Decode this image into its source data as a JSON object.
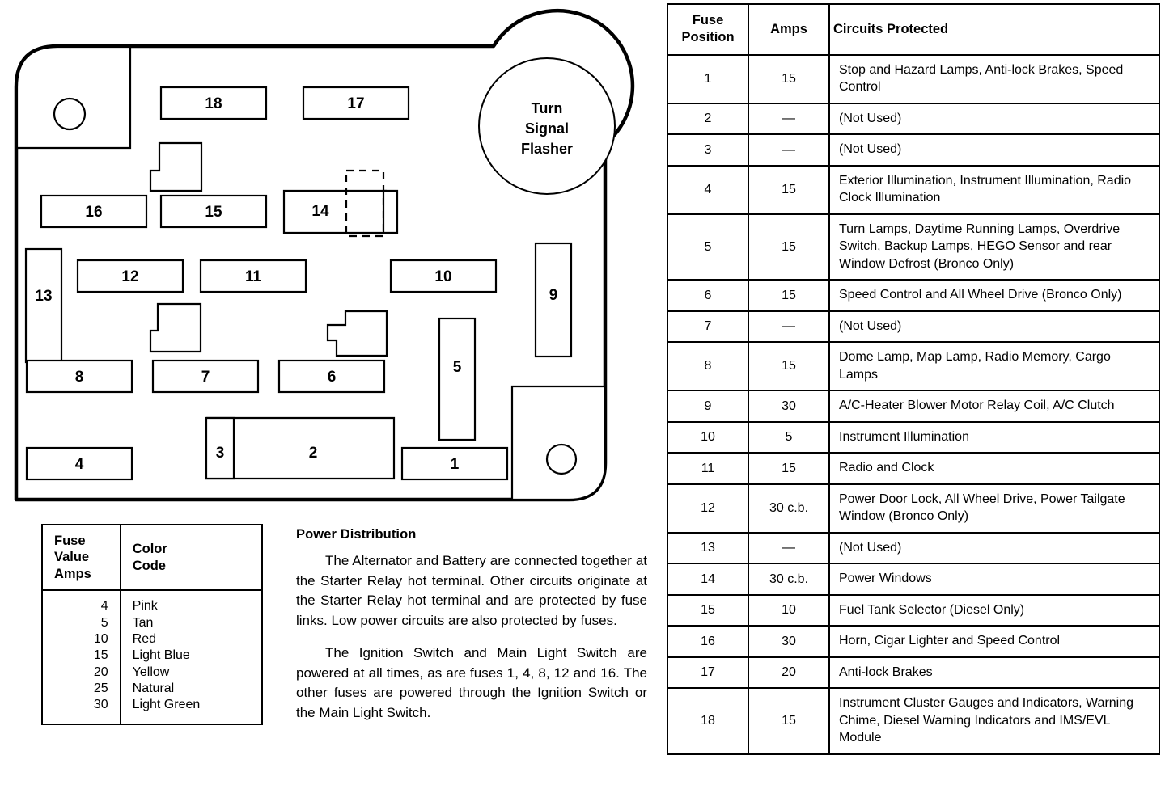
{
  "diagram": {
    "title": "fuse-panel-diagram",
    "flasher_label_lines": [
      "Turn",
      "Signal",
      "Flasher"
    ],
    "fuse_slots": [
      {
        "id": "18",
        "label": "18"
      },
      {
        "id": "17",
        "label": "17"
      },
      {
        "id": "16",
        "label": "16"
      },
      {
        "id": "15",
        "label": "15"
      },
      {
        "id": "14",
        "label": "14"
      },
      {
        "id": "13",
        "label": "13"
      },
      {
        "id": "12",
        "label": "12"
      },
      {
        "id": "11",
        "label": "11"
      },
      {
        "id": "10",
        "label": "10"
      },
      {
        "id": "9",
        "label": "9"
      },
      {
        "id": "8",
        "label": "8"
      },
      {
        "id": "7",
        "label": "7"
      },
      {
        "id": "6",
        "label": "6"
      },
      {
        "id": "5",
        "label": "5"
      },
      {
        "id": "4",
        "label": "4"
      },
      {
        "id": "3",
        "label": "3"
      },
      {
        "id": "2",
        "label": "2"
      },
      {
        "id": "1",
        "label": "1"
      }
    ]
  },
  "legend": {
    "header_amps_lines": [
      "Fuse",
      "Value",
      "Amps"
    ],
    "header_color_lines": [
      "Color",
      "Code"
    ],
    "rows": [
      {
        "amps": "4",
        "color": "Pink"
      },
      {
        "amps": "5",
        "color": "Tan"
      },
      {
        "amps": "10",
        "color": "Red"
      },
      {
        "amps": "15",
        "color": "Light Blue"
      },
      {
        "amps": "20",
        "color": "Yellow"
      },
      {
        "amps": "25",
        "color": "Natural"
      },
      {
        "amps": "30",
        "color": "Light Green"
      }
    ]
  },
  "prose": {
    "heading": "Power Distribution",
    "paragraph_1": "The Alternator and Battery are connected together at the Starter Relay hot terminal. Other circuits originate at the Starter Relay hot terminal and are protected by fuse links. Low power circuits are also protected by fuses.",
    "paragraph_2": "The Ignition Switch and Main Light Switch are powered at all times, as are fuses 1, 4, 8, 12 and 16. The other fuses are powered through the Ignition Switch or the Main Light Switch."
  },
  "fuse_table": {
    "headers": {
      "position_line_1": "Fuse",
      "position_line_2": "Position",
      "amps": "Amps",
      "circuits": "Circuits Protected"
    },
    "rows": [
      {
        "position": "1",
        "amps": "15",
        "circuits": "Stop and Hazard Lamps, Anti-lock Brakes, Speed Control"
      },
      {
        "position": "2",
        "amps": "—",
        "circuits": "(Not Used)"
      },
      {
        "position": "3",
        "amps": "—",
        "circuits": "(Not Used)"
      },
      {
        "position": "4",
        "amps": "15",
        "circuits": "Exterior Illumination, Instrument Illumination, Radio Clock Illumination"
      },
      {
        "position": "5",
        "amps": "15",
        "circuits": "Turn Lamps, Daytime Running Lamps, Overdrive Switch, Backup Lamps, HEGO Sensor and rear Window Defrost (Bronco Only)"
      },
      {
        "position": "6",
        "amps": "15",
        "circuits": "Speed Control and All Wheel Drive (Bronco Only)"
      },
      {
        "position": "7",
        "amps": "—",
        "circuits": "(Not Used)"
      },
      {
        "position": "8",
        "amps": "15",
        "circuits": "Dome Lamp, Map Lamp, Radio Memory, Cargo Lamps"
      },
      {
        "position": "9",
        "amps": "30",
        "circuits": "A/C-Heater Blower Motor Relay Coil, A/C Clutch"
      },
      {
        "position": "10",
        "amps": "5",
        "circuits": "Instrument Illumination"
      },
      {
        "position": "11",
        "amps": "15",
        "circuits": "Radio and Clock"
      },
      {
        "position": "12",
        "amps": "30 c.b.",
        "circuits": "Power Door Lock, All Wheel Drive, Power Tailgate Window (Bronco Only)"
      },
      {
        "position": "13",
        "amps": "—",
        "circuits": "(Not Used)"
      },
      {
        "position": "14",
        "amps": "30 c.b.",
        "circuits": "Power Windows"
      },
      {
        "position": "15",
        "amps": "10",
        "circuits": "Fuel Tank Selector (Diesel Only)"
      },
      {
        "position": "16",
        "amps": "30",
        "circuits": "Horn, Cigar Lighter and Speed Control"
      },
      {
        "position": "17",
        "amps": "20",
        "circuits": "Anti-lock Brakes"
      },
      {
        "position": "18",
        "amps": "15",
        "circuits": "Instrument Cluster Gauges and Indicators, Warning Chime, Diesel Warning Indicators and IMS/EVL Module"
      }
    ]
  }
}
